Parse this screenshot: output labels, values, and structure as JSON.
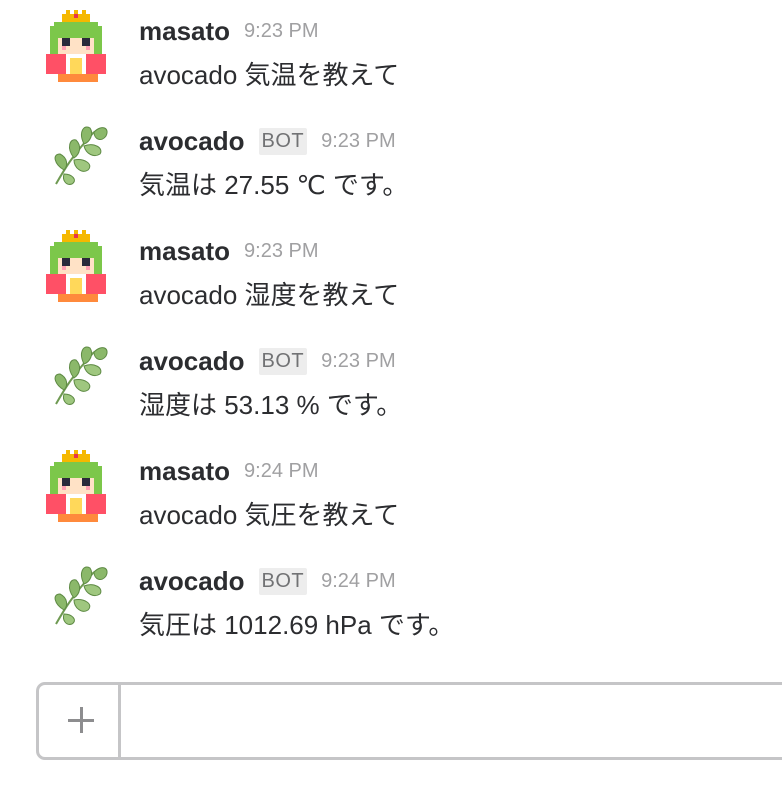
{
  "messages": [
    {
      "author": "masato",
      "is_bot": false,
      "time": "9:23 PM",
      "text": "avocado 気温を教えて",
      "avatar": "pixel-girl-avatar"
    },
    {
      "author": "avocado",
      "is_bot": true,
      "badge": "BOT",
      "time": "9:23 PM",
      "text": "気温は 27.55 ℃ です。",
      "avatar": "leaf-branch-avatar"
    },
    {
      "author": "masato",
      "is_bot": false,
      "time": "9:23 PM",
      "text": "avocado 湿度を教えて",
      "avatar": "pixel-girl-avatar"
    },
    {
      "author": "avocado",
      "is_bot": true,
      "badge": "BOT",
      "time": "9:23 PM",
      "text": "湿度は 53.13 % です。",
      "avatar": "leaf-branch-avatar"
    },
    {
      "author": "masato",
      "is_bot": false,
      "time": "9:24 PM",
      "text": "avocado 気圧を教えて",
      "avatar": "pixel-girl-avatar"
    },
    {
      "author": "avocado",
      "is_bot": true,
      "badge": "BOT",
      "time": "9:24 PM",
      "text": "気圧は 1012.69 hPa です。",
      "avatar": "leaf-branch-avatar"
    }
  ],
  "composer": {
    "plus_icon": "plus-icon",
    "input_value": "",
    "placeholder": ""
  },
  "colors": {
    "text": "#2c2d30",
    "timestamp": "#a0a0a2",
    "badge_bg": "#ededed",
    "border": "#c5c5c7",
    "leaf": "#8bb86a",
    "hair": "#7cc74a"
  }
}
